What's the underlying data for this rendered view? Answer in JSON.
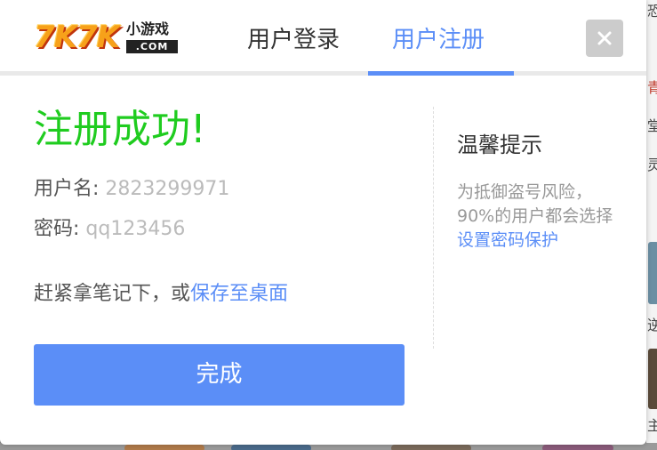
{
  "background": {
    "edge_chars": [
      "恐",
      "青",
      "堂",
      "灵",
      "逆",
      "主"
    ]
  },
  "header": {
    "logo": {
      "main": "7K7K",
      "sub": "小游戏",
      "domain": ".COM"
    },
    "tabs": [
      {
        "label": "用户登录",
        "active": false
      },
      {
        "label": "用户注册",
        "active": true
      }
    ],
    "close_icon": "close-icon"
  },
  "main": {
    "title": "注册成功!",
    "username_label": "用户名:",
    "username_value": "2823299971",
    "password_label": "密码:",
    "password_value": "qq123456",
    "notice_prefix": "赶紧拿笔记下，或",
    "notice_link": "保存至桌面",
    "done_button": "完成"
  },
  "tips": {
    "title": "温馨提示",
    "text_prefix": "为抵御盗号风险，90%的用户都会选择",
    "text_link": "设置密码保护"
  },
  "colors": {
    "accent": "#5b8ef7",
    "success": "#1fcc1f",
    "muted": "#999999"
  }
}
